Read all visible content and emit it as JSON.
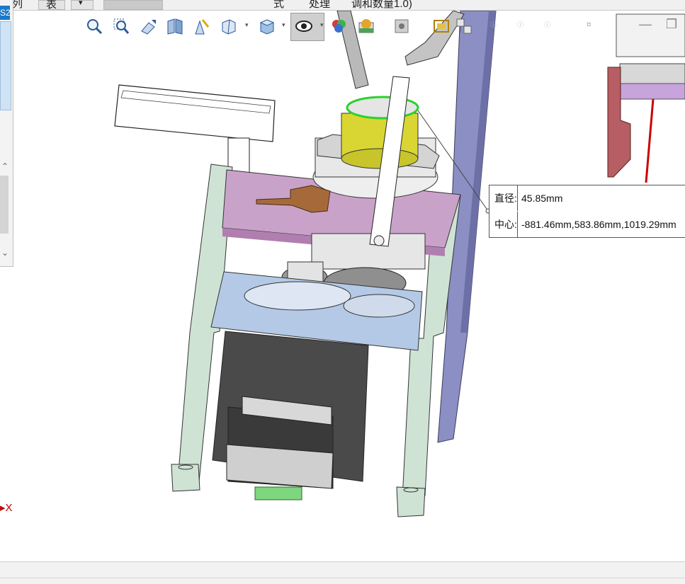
{
  "menu": {
    "items": [
      "阵列",
      "表",
      "式",
      "处理",
      "调和数量1.0)"
    ],
    "dropdown_arrow": "▾"
  },
  "left_panel": {
    "tab_label": "S2",
    "up_glyph": "⌃",
    "down_glyph": "⌄"
  },
  "hud_toolbar": {
    "icons": [
      "zoom-to-fit-icon",
      "zoom-area-icon",
      "previous-view-icon",
      "section-view-icon",
      "dynamic-annotation-icon",
      "view-orientation-icon",
      "display-style-icon",
      "hide-show-items-icon",
      "edit-appearance-icon",
      "apply-scene-icon",
      "view-settings-icon",
      "screen-capture-icon",
      "orient-icon"
    ]
  },
  "window_controls": {
    "restore_left": "▫",
    "minimize": "—",
    "restore": "❐"
  },
  "measure_tooltip": {
    "diameter_label": "直径:",
    "diameter_value": "45.85mm",
    "center_label": "中心:",
    "center_value": "-881.46mm,583.86mm,1019.29mm"
  },
  "triad": {
    "x_label": "X",
    "x_color": "#cc0000"
  },
  "colors": {
    "selection_green": "#2bd12b",
    "frame_green": "#cfe3d5",
    "plate_pink": "#c9a2c9",
    "plate_blue": "#b4c9e6",
    "motor_dark": "#4a4a4a",
    "hub_yellow": "#d9d634",
    "rail_purple": "#8b8fc4",
    "brown_part": "#a66a3a"
  }
}
